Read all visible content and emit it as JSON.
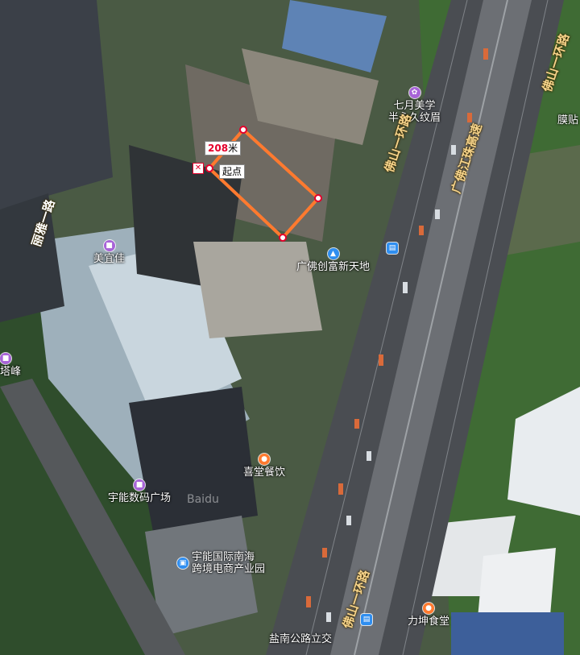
{
  "measure": {
    "distance_value": "208",
    "distance_unit": "米",
    "start_label": "起点",
    "close_icon": "close-icon",
    "line_color": "#ff7a2f"
  },
  "pois": {
    "qiyue": {
      "line1": "七月美学",
      "line2": "半永久纹眉",
      "icon": "beauty-icon",
      "color": "#a864d8"
    },
    "meiyijia": {
      "name": "美宜佳",
      "icon": "shop-icon",
      "color": "#a864d8"
    },
    "guangfo": {
      "name": "广佛创富新天地",
      "icon": "building-icon",
      "color": "#2f8ef0"
    },
    "xitang": {
      "name": "喜堂餐饮",
      "icon": "food-icon",
      "color": "#ff7a2f"
    },
    "yuneng_digital": {
      "name": "宇能数码广场",
      "icon": "shop-icon",
      "color": "#a864d8"
    },
    "yuneng_park": {
      "line1": "宇能国际南海",
      "line2": "跨境电商产业园",
      "icon": "office-icon",
      "color": "#2f8ef0"
    },
    "likun": {
      "name": "力坤食堂",
      "icon": "food-icon",
      "color": "#ff7a2f"
    },
    "tafeng": {
      "name": "塔峰",
      "icon": "shop-icon",
      "color": "#a864d8"
    },
    "yannan": {
      "name": "盐南公路立交"
    },
    "mo_tie": {
      "name": "膜贴"
    },
    "bus_icon": "bus-stop-icon"
  },
  "roads": {
    "foshan_ring_a": "佛山一环路",
    "foshan_ring_b": "佛山一环路",
    "guangfo_express": "广佛江珠高速",
    "ring_top_right": "佛山一环路",
    "ring_bottom": "佛山一环路",
    "left_road": "丽雅一路"
  },
  "watermark": "Baidu"
}
